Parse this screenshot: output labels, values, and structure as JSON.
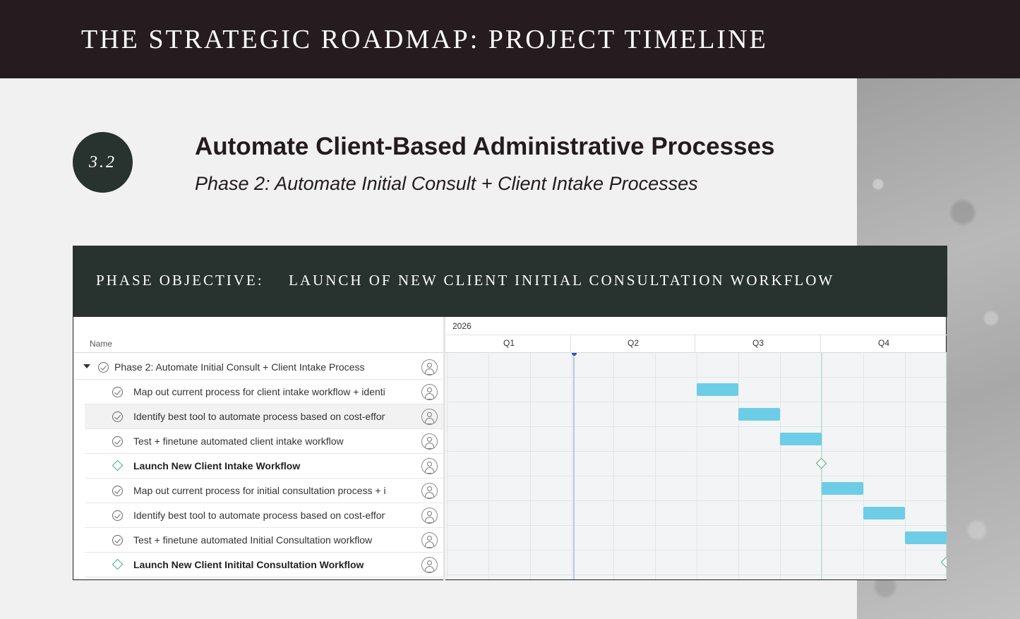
{
  "page_title": "THE STRATEGIC ROADMAP: PROJECT TIMELINE",
  "section_number": "3.2",
  "heading": "Automate Client-Based Administrative Processes",
  "subheading": "Phase 2: Automate Initial Consult + Client Intake Processes",
  "objective": {
    "label": "PHASE OBJECTIVE:",
    "value": "LAUNCH OF NEW CLIENT INITIAL CONSULTATION WORKFLOW"
  },
  "gantt": {
    "name_header": "Name",
    "year": "2026",
    "quarters": [
      "Q1",
      "Q2",
      "Q3",
      "Q4"
    ],
    "rows": [
      {
        "label": "Phase 2: Automate Initial Consult + Client Intake Process",
        "kind": "summary",
        "icon": "check-circle-icon"
      },
      {
        "label": "Map out current process for client intake workflow + identi",
        "kind": "task",
        "icon": "check-circle-icon"
      },
      {
        "label": "Identify best tool to automate process based on cost-effort",
        "kind": "task",
        "icon": "check-circle-icon"
      },
      {
        "label": "Test + finetune automated client intake workflow",
        "kind": "task",
        "icon": "check-circle-icon"
      },
      {
        "label": "Launch New Client Intake Workflow",
        "kind": "milestone",
        "icon": "diamond-icon"
      },
      {
        "label": "Map out current process for initial consultation process + ic",
        "kind": "task",
        "icon": "check-circle-icon"
      },
      {
        "label": "Identify best tool to automate process based on cost-effort",
        "kind": "task",
        "icon": "check-circle-icon"
      },
      {
        "label": "Test + finetune automated Initial Consultation workflow",
        "kind": "task",
        "icon": "check-circle-icon"
      },
      {
        "label": "Launch New Client Initital Consultation Workflow",
        "kind": "milestone",
        "icon": "diamond-icon"
      }
    ],
    "schedule_units": "months of 2026 (0 = start of January)",
    "today_month": 3.05,
    "bars": [
      {
        "row": 1,
        "start": 6.0,
        "end": 7.0
      },
      {
        "row": 2,
        "start": 7.0,
        "end": 8.0
      },
      {
        "row": 3,
        "start": 8.0,
        "end": 9.0
      },
      {
        "row": 5,
        "start": 9.0,
        "end": 10.0
      },
      {
        "row": 6,
        "start": 10.0,
        "end": 11.0
      },
      {
        "row": 7,
        "start": 11.0,
        "end": 12.0
      }
    ],
    "milestones": [
      {
        "row": 4,
        "month": 9.0
      },
      {
        "row": 8,
        "month": 12.0
      }
    ]
  },
  "colors": {
    "header_bg": "#261c20",
    "panel_bg": "#28322f",
    "bar": "#6dcde6",
    "milestone": "#3fae79",
    "today_dot": "#2a56c6"
  }
}
